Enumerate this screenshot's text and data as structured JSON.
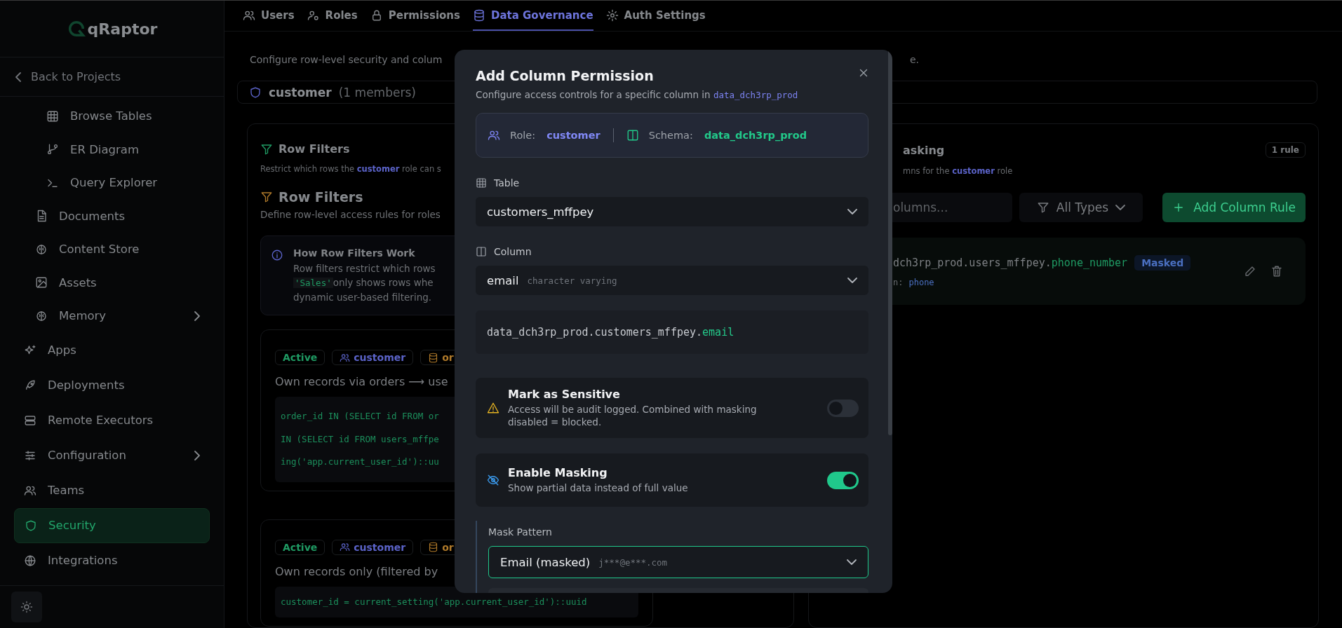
{
  "sidebar": {
    "logo": "qRaptor",
    "back": "Back to Projects",
    "project_items": [
      {
        "children": [
          {
            "label": "Browse Tables"
          },
          {
            "label": "ER Diagram"
          },
          {
            "label": "Query Explorer"
          }
        ]
      },
      {
        "label": "Documents",
        "expandable": false
      },
      {
        "label": "Content Store",
        "expandable": false
      },
      {
        "label": "Assets",
        "expandable": false
      },
      {
        "label": "Memory",
        "expandable": true
      }
    ],
    "items": [
      {
        "label": "Apps",
        "expandable": false,
        "selected": false
      },
      {
        "label": "Deployments",
        "expandable": false,
        "selected": false
      },
      {
        "label": "Remote Executors",
        "expandable": false,
        "selected": false
      },
      {
        "label": "Configuration",
        "expandable": true,
        "selected": false
      },
      {
        "label": "Teams",
        "expandable": false,
        "selected": false
      },
      {
        "label": "Security",
        "expandable": false,
        "selected": true
      },
      {
        "label": "Integrations",
        "expandable": false,
        "selected": false
      }
    ]
  },
  "tabs": [
    {
      "label": "Users",
      "selected": false
    },
    {
      "label": "Roles",
      "selected": false
    },
    {
      "label": "Permissions",
      "selected": false
    },
    {
      "label": "Data Governance",
      "selected": true
    },
    {
      "label": "Auth Settings",
      "selected": false
    }
  ],
  "description": {
    "left": "Configure row-level security and colum",
    "right": "e."
  },
  "role_bar": {
    "name": "customer",
    "members": "(1 members)"
  },
  "row_filters": {
    "title": "Row Filters",
    "subtitle": "Restrict which rows the **customer** role can s",
    "heading": "Row Filters",
    "heading_subtitle": "Define row-level access rules for roles",
    "info": {
      "title": "How Row Filters Work",
      "lines": [
        {
          "text": "Row filters restrict which rows"
        },
        {
          "code": "'Sales'",
          "text": "only shows rows whe"
        },
        {
          "text": "dynamic user-based filtering."
        }
      ]
    },
    "rules": [
      {
        "status": "Active",
        "role": "customer",
        "table": "or",
        "title": "Own records via orders ⟶ use",
        "code": [
          "order_id IN (SELECT id FROM or",
          "IN (SELECT id FROM users_mffpe",
          "ing('app.current_user_id')::uu"
        ]
      },
      {
        "status": "Active",
        "role": "customer",
        "table": "or",
        "title": "Own records only (filtered by",
        "code": [
          "customer_id = current_setting('app.current_user_id')::uuid"
        ]
      }
    ]
  },
  "masking": {
    "title": "asking",
    "count": "1 rule",
    "subtitle": "mns for the **customer** role",
    "search": {
      "placeholder": "olumns..."
    },
    "filter": "All Types",
    "add_button": "Add Column Rule",
    "rules": [
      {
        "path": "dch3rp_prod.users_mffpey.",
        "column": "phone_number",
        "badge": "Masked",
        "detail_label": "n:",
        "detail_value": "phone"
      }
    ]
  },
  "modal": {
    "title": "Add Column Permission",
    "subtitle": {
      "text": "Configure access controls for a specific column in",
      "code": "data_dch3rp_prod"
    },
    "context": {
      "role_label": "Role:",
      "role": "customer",
      "schema_label": "Schema:",
      "schema": "data_dch3rp_prod"
    },
    "table": {
      "label": "Table",
      "value": "customers_mffpey"
    },
    "column": {
      "label": "Column",
      "value": "email",
      "type": "character varying"
    },
    "path": {
      "prefix": "data_dch3rp_prod.customers_mffpey.",
      "column": "email"
    },
    "sensitive": {
      "title": "Mark as Sensitive",
      "description": "Access will be audit logged. Combined with masking disabled = blocked.",
      "on": false
    },
    "masking": {
      "title": "Enable Masking",
      "description": "Show partial data instead of full value",
      "on": true
    },
    "mask_pattern": {
      "label": "Mask Pattern",
      "value": "Email (masked)",
      "example": "j***@e***.com"
    }
  }
}
